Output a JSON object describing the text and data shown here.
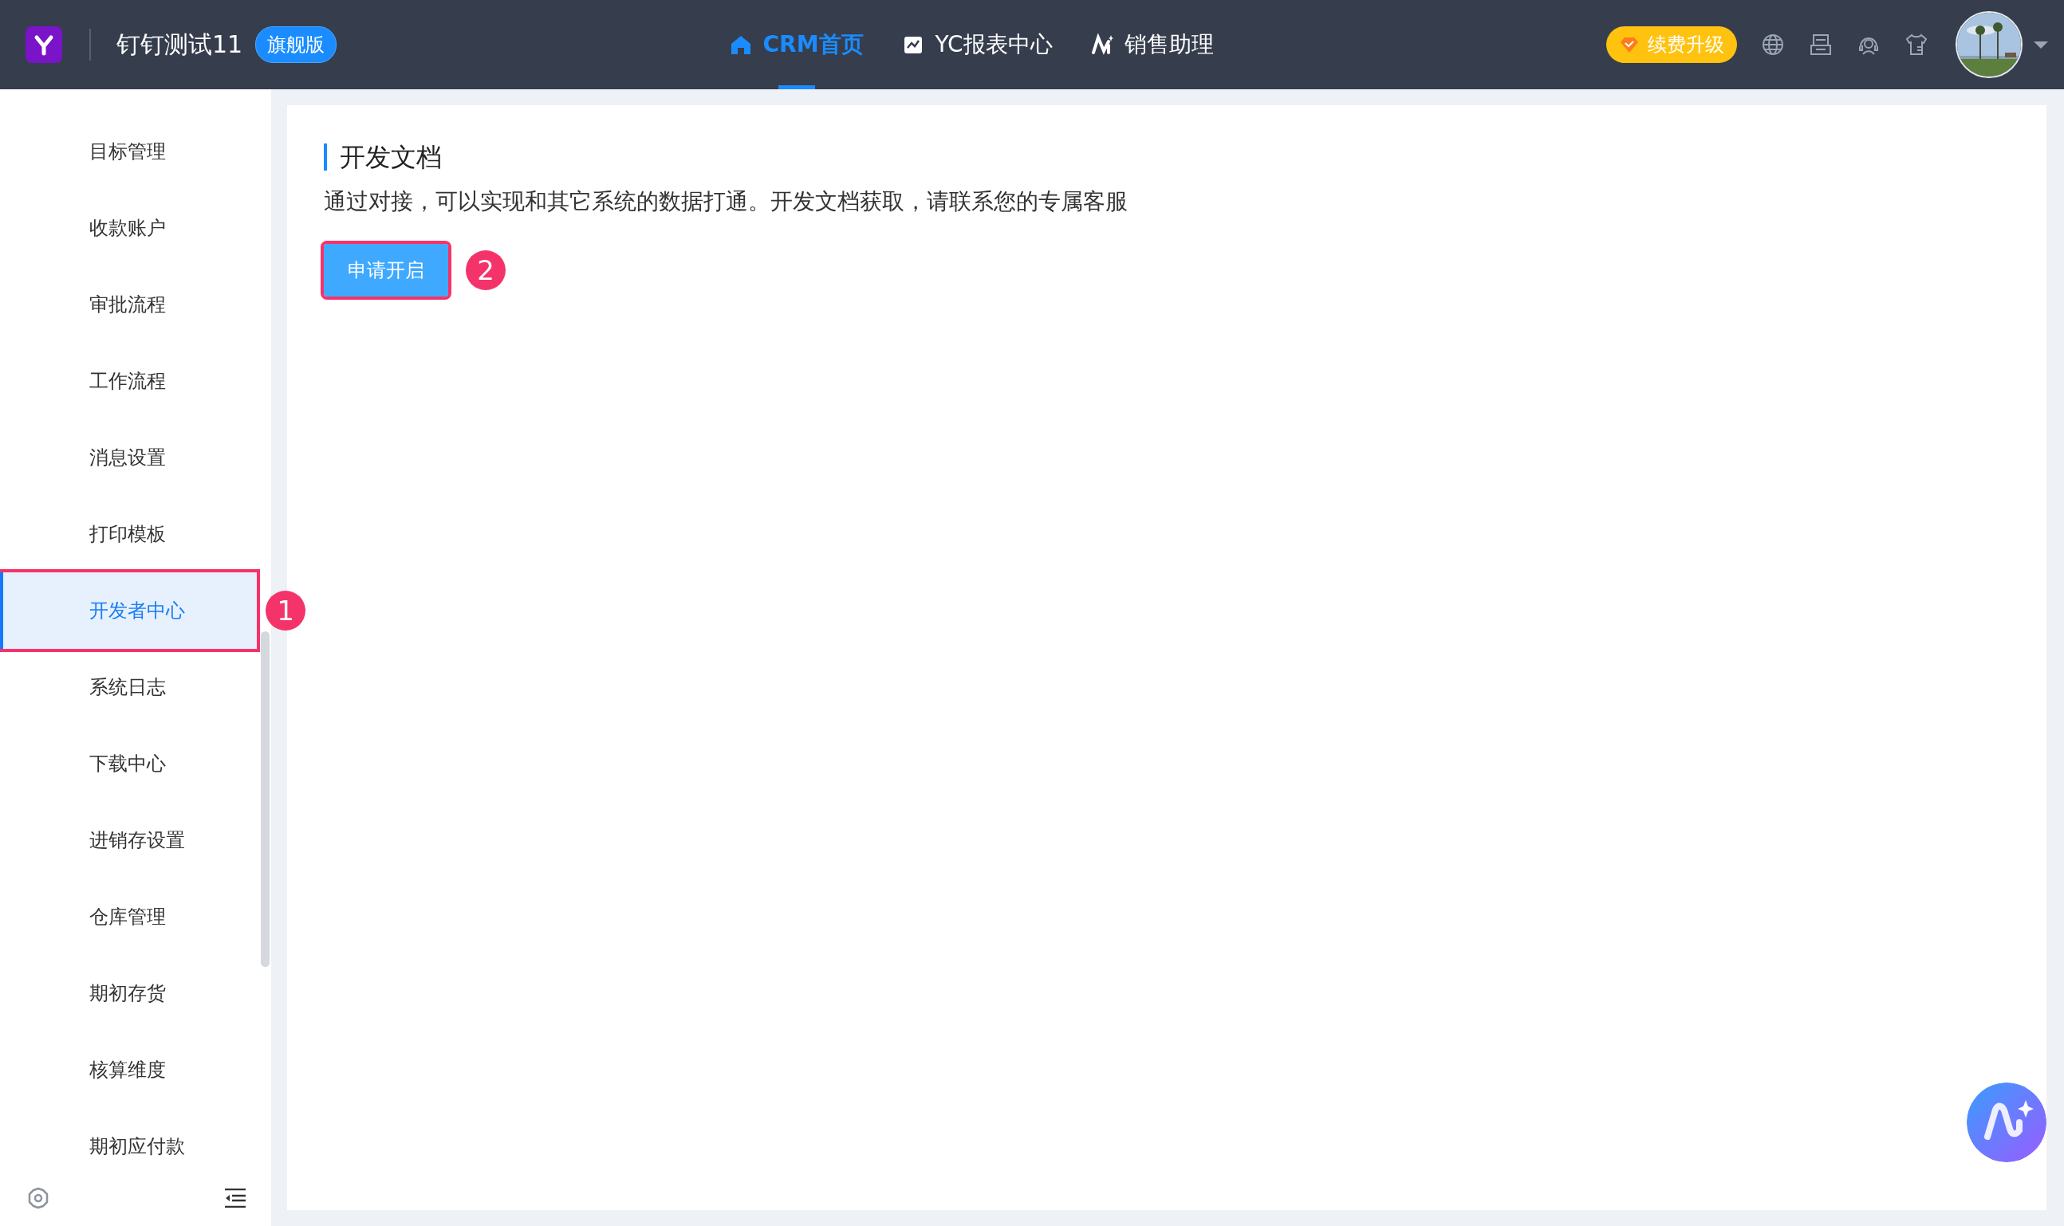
{
  "top_bar": {
    "app_title": "钉钉测试11",
    "edition_badge": "旗舰版",
    "nav": [
      {
        "label": "CRM首页",
        "selected": true
      },
      {
        "label": "YC报表中心",
        "selected": false
      },
      {
        "label": "销售助理",
        "selected": false
      }
    ],
    "upgrade_button": "续费升级"
  },
  "sidebar": {
    "items": [
      {
        "label": "目标管理",
        "selected": false
      },
      {
        "label": "收款账户",
        "selected": false
      },
      {
        "label": "审批流程",
        "selected": false
      },
      {
        "label": "工作流程",
        "selected": false
      },
      {
        "label": "消息设置",
        "selected": false
      },
      {
        "label": "打印模板",
        "selected": false
      },
      {
        "label": "开发者中心",
        "selected": true,
        "annotation": "1"
      },
      {
        "label": "系统日志",
        "selected": false
      },
      {
        "label": "下载中心",
        "selected": false
      },
      {
        "label": "进销存设置",
        "selected": false
      },
      {
        "label": "仓库管理",
        "selected": false
      },
      {
        "label": "期初存货",
        "selected": false
      },
      {
        "label": "核算维度",
        "selected": false
      },
      {
        "label": "期初应付款",
        "selected": false
      }
    ]
  },
  "content": {
    "title": "开发文档",
    "description": "通过对接，可以实现和其它系统的数据打通。开发文档获取，请联系您的专属客服",
    "button": {
      "label": "申请开启",
      "annotation": "2"
    }
  }
}
